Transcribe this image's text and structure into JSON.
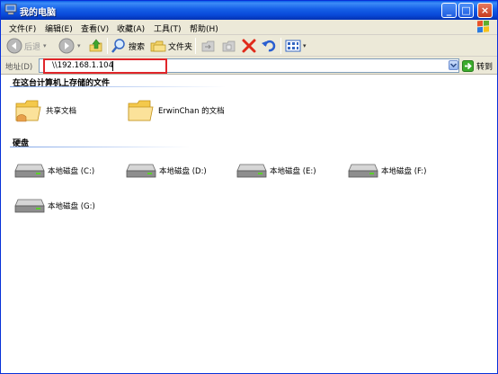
{
  "window": {
    "title": "我的电脑"
  },
  "menu": [
    "文件(F)",
    "编辑(E)",
    "查看(V)",
    "收藏(A)",
    "工具(T)",
    "帮助(H)"
  ],
  "toolbar": {
    "back_label": "后退",
    "search_label": "搜索",
    "folders_label": "文件夹"
  },
  "address": {
    "label": "地址(D)",
    "value": "\\\\192.168.1.104",
    "go_label": "转到"
  },
  "groups": {
    "files": {
      "title": "在这台计算机上存储的文件",
      "items": [
        "共享文档",
        "ErwinChan 的文档"
      ]
    },
    "drives": {
      "title": "硬盘",
      "items": [
        "本地磁盘 (C:)",
        "本地磁盘 (D:)",
        "本地磁盘 (E:)",
        "本地磁盘 (F:)",
        "本地磁盘 (G:)"
      ]
    }
  }
}
